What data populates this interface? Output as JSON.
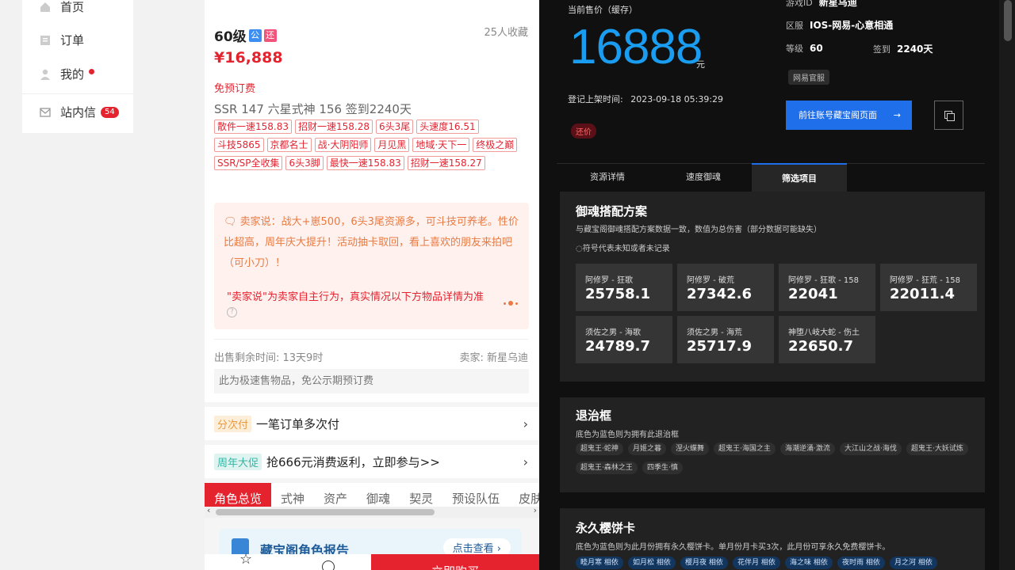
{
  "nav": {
    "items": [
      {
        "label": "首页"
      },
      {
        "label": "订单"
      },
      {
        "label": "我的"
      },
      {
        "label": "站内信",
        "badge": "54"
      }
    ]
  },
  "listing": {
    "level": "60级",
    "favorites": "25人收藏",
    "price": "¥16,888",
    "no_fee": "免预订费",
    "stats": "SSR 147   六星式神 156   签到2240天",
    "tags": [
      "散件一速158.83",
      "招财一速158.28",
      "6头3尾",
      "头速度16.51",
      "斗技5865",
      "京都名士",
      "战·大阴阳师",
      "月见黑",
      "地域·天下一",
      "终极之巅",
      "SSR/SP全收集",
      "6头3脚",
      "最快一速158.83",
      "招财一速158.27"
    ],
    "seller_says": "卖家说：战大+崽500，6头3尾资源多，可斗技可养老。性价比超高，周年庆大提升！活动抽卡取回，看上喜欢的朋友来拍吧（可小刀）！",
    "seller_note": "\"卖家说\"为卖家自主行为，真实情况以下方物品详情为准",
    "remaining": "出售剩余时间: 13天9时",
    "seller": "卖家: 新星乌迪",
    "fast_notice": "此为极速售物品，免公示期预订费"
  },
  "rows": {
    "installment_pill": "分次付",
    "installment_text": "一笔订单多次付",
    "promo_pill": "周年大促",
    "promo_text": "抢666元消费返利，立即参与>>"
  },
  "tabs": [
    "角色总览",
    "式神",
    "资产",
    "御魂",
    "契灵",
    "预设队伍",
    "皮肤"
  ],
  "report": {
    "title": "藏宝阁角色报告",
    "button": "点击查看"
  },
  "bottom": {
    "buy": "立即购买"
  },
  "dark": {
    "price_label": "当前售价（缓存）",
    "price": "16888",
    "yuan": "元",
    "listed_label": "登记上架时间:",
    "listed_time": "2023-09-18 05:39:29",
    "bargain": "还价",
    "game_id_label": "游戏ID",
    "game_id": "新星乌迪",
    "server_label": "区服",
    "server": "IOS-网易-心意相通",
    "level_label": "等级",
    "level": "60",
    "signin_label": "签到",
    "signin": "2240天",
    "official_tag": "网易官服",
    "goto_btn": "前往账号藏宝阁页面",
    "tabs": [
      "资源详情",
      "速度御魂",
      "筛选项目"
    ],
    "soul_section": {
      "title": "御魂搭配方案",
      "subtitle": "与藏宝阁御魂搭配方案数据一致，数值为总伤害（部分数据可能缺失）",
      "note": "◌符号代表未知或者未记录",
      "cards": [
        {
          "name": "阿修罗 - 狂歌",
          "value": "25758.1"
        },
        {
          "name": "阿修罗 - 破荒",
          "value": "27342.6"
        },
        {
          "name": "阿修罗 - 狂歌 - 158",
          "value": "22041"
        },
        {
          "name": "阿修罗 - 狂荒 - 158",
          "value": "22011.4"
        },
        {
          "name": "须佐之男 - 海歌",
          "value": "24789.7"
        },
        {
          "name": "须佐之男 - 海荒",
          "value": "25717.9"
        },
        {
          "name": "神堕八岐大蛇 - 伤土",
          "value": "22650.7"
        }
      ]
    },
    "frame_section": {
      "title": "退治框",
      "subtitle": "底色为蓝色则为拥有此退治框",
      "chips": [
        "超鬼王·蛇神",
        "月姬之暮",
        "涅火蝶舞",
        "超鬼王·海国之主",
        "海潮逆涌·激流",
        "大江山之战·海伐",
        "超鬼王·大妖试炼",
        "超鬼王·森林之王",
        "四季生·慎"
      ]
    },
    "card_section": {
      "title": "永久樱饼卡",
      "subtitle": "底色为蓝色则为此月份拥有永久樱饼卡。单月份月卡买3次，此月份可享永久免费樱饼卡。",
      "chips": [
        "睦月寒 相依",
        "如月松 相依",
        "樱月夜 相依",
        "花伴月 相依",
        "海之味 相依",
        "夜时雨 相依",
        "月之河 相依"
      ]
    }
  }
}
